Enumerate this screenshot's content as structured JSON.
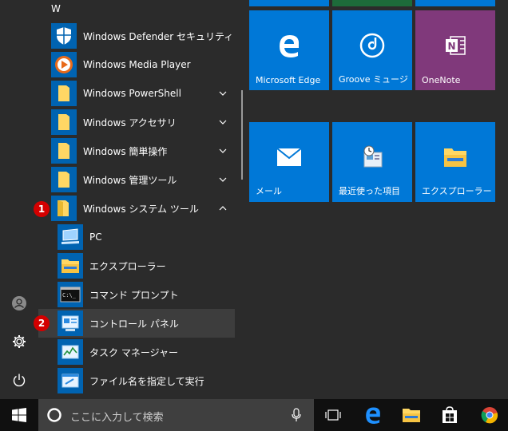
{
  "start_menu": {
    "section_letter": "W",
    "apps": [
      {
        "label": "Windows Defender セキュリティ セン...",
        "icon": "shield-icon"
      },
      {
        "label": "Windows Media Player",
        "icon": "media-player-icon"
      },
      {
        "label": "Windows PowerShell",
        "icon": "folder-icon",
        "expandable": true
      },
      {
        "label": "Windows アクセサリ",
        "icon": "folder-icon",
        "expandable": true
      },
      {
        "label": "Windows 簡単操作",
        "icon": "folder-icon",
        "expandable": true
      },
      {
        "label": "Windows 管理ツール",
        "icon": "folder-icon",
        "expandable": true
      },
      {
        "label": "Windows システム ツール",
        "icon": "folder-icon",
        "expanded": true
      }
    ],
    "system_tools": [
      {
        "label": "PC",
        "icon": "computer-icon"
      },
      {
        "label": "エクスプローラー",
        "icon": "folder-icon"
      },
      {
        "label": "コマンド プロンプト",
        "icon": "command-prompt-icon"
      },
      {
        "label": "コントロール パネル",
        "icon": "control-panel-icon",
        "highlighted": true
      },
      {
        "label": "タスク マネージャー",
        "icon": "task-manager-icon"
      },
      {
        "label": "ファイル名を指定して実行",
        "icon": "run-icon"
      }
    ],
    "badges": [
      "1",
      "2"
    ]
  },
  "tiles": [
    {
      "label": "Microsoft Edge",
      "color": "#0078d7",
      "icon": "edge-icon"
    },
    {
      "label": "Groove ミュージ...",
      "color": "#0078d7",
      "icon": "groove-music-icon"
    },
    {
      "label": "OneNote",
      "color": "#80397b",
      "icon": "onenote-icon"
    },
    {
      "label": "メール",
      "color": "#0078d7",
      "icon": "mail-icon"
    },
    {
      "label": "最近使った項目",
      "color": "#0078d7",
      "icon": "recent-items-icon"
    },
    {
      "label": "エクスプローラー",
      "color": "#0078d7",
      "icon": "explorer-icon"
    }
  ],
  "taskbar": {
    "search_placeholder": "ここに入力して検索"
  },
  "colors": {
    "accent": "#0078d7",
    "icon_blue": "#0063b1",
    "badge_red": "#d40000"
  }
}
